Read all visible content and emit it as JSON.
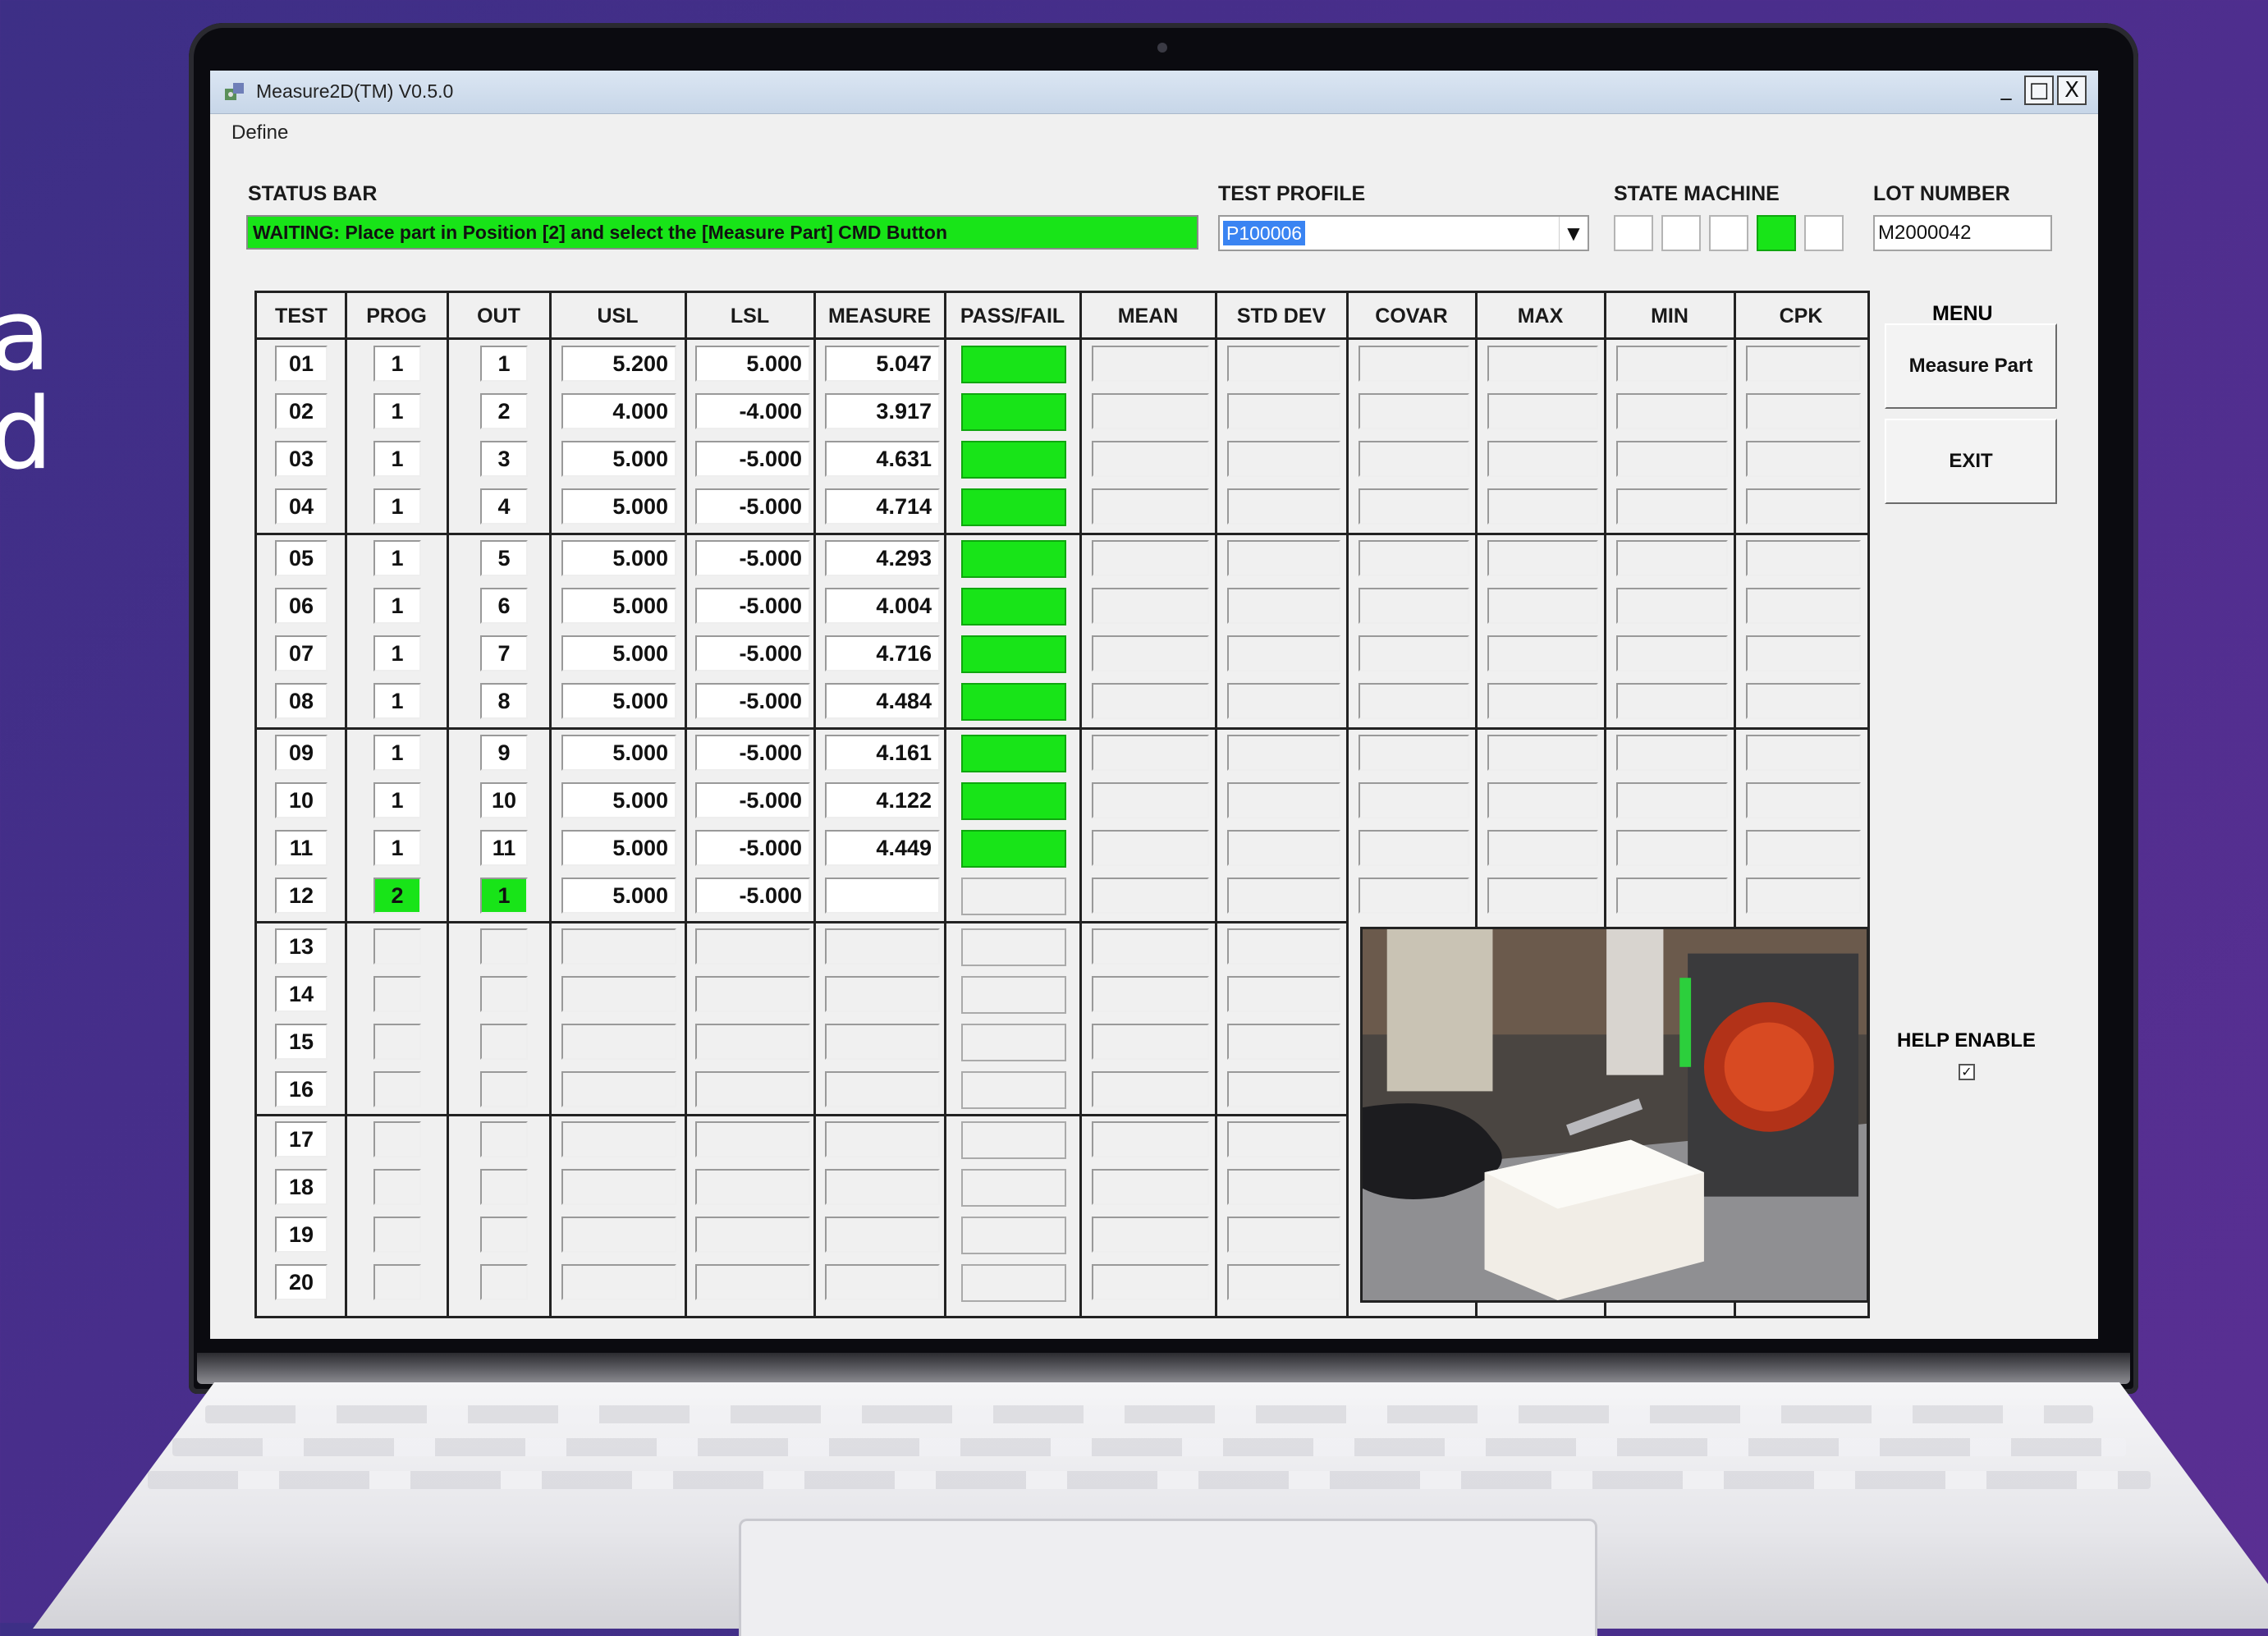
{
  "background_text": [
    "a",
    "d"
  ],
  "window": {
    "title": "Measure2D(TM) V0.5.0",
    "menu": [
      "Define"
    ],
    "controls": [
      "_",
      "□",
      "X"
    ]
  },
  "status": {
    "label": "STATUS BAR",
    "text": "WAITING: Place part in Position [2] and select the [Measure Part] CMD Button",
    "color": "#18e418"
  },
  "test_profile": {
    "label": "TEST PROFILE",
    "value": "P100006"
  },
  "state_machine": {
    "label": "STATE MACHINE",
    "states": [
      false,
      false,
      false,
      true,
      false
    ]
  },
  "lot_number": {
    "label": "LOT NUMBER",
    "value": "M2000042"
  },
  "columns": [
    "TEST",
    "PROG",
    "OUT",
    "USL",
    "LSL",
    "MEASURE",
    "PASS/FAIL",
    "MEAN",
    "STD DEV",
    "COVAR",
    "MAX",
    "MIN",
    "CPK"
  ],
  "rows": [
    {
      "test": "01",
      "prog": "1",
      "out": "1",
      "usl": "5.200",
      "lsl": "5.000",
      "measure": "5.047",
      "pass": true
    },
    {
      "test": "02",
      "prog": "1",
      "out": "2",
      "usl": "4.000",
      "lsl": "-4.000",
      "measure": "3.917",
      "pass": true
    },
    {
      "test": "03",
      "prog": "1",
      "out": "3",
      "usl": "5.000",
      "lsl": "-5.000",
      "measure": "4.631",
      "pass": true
    },
    {
      "test": "04",
      "prog": "1",
      "out": "4",
      "usl": "5.000",
      "lsl": "-5.000",
      "measure": "4.714",
      "pass": true
    },
    {
      "test": "05",
      "prog": "1",
      "out": "5",
      "usl": "5.000",
      "lsl": "-5.000",
      "measure": "4.293",
      "pass": true
    },
    {
      "test": "06",
      "prog": "1",
      "out": "6",
      "usl": "5.000",
      "lsl": "-5.000",
      "measure": "4.004",
      "pass": true
    },
    {
      "test": "07",
      "prog": "1",
      "out": "7",
      "usl": "5.000",
      "lsl": "-5.000",
      "measure": "4.716",
      "pass": true
    },
    {
      "test": "08",
      "prog": "1",
      "out": "8",
      "usl": "5.000",
      "lsl": "-5.000",
      "measure": "4.484",
      "pass": true
    },
    {
      "test": "09",
      "prog": "1",
      "out": "9",
      "usl": "5.000",
      "lsl": "-5.000",
      "measure": "4.161",
      "pass": true
    },
    {
      "test": "10",
      "prog": "1",
      "out": "10",
      "usl": "5.000",
      "lsl": "-5.000",
      "measure": "4.122",
      "pass": true
    },
    {
      "test": "11",
      "prog": "1",
      "out": "11",
      "usl": "5.000",
      "lsl": "-5.000",
      "measure": "4.449",
      "pass": true
    },
    {
      "test": "12",
      "prog": "2",
      "out": "1",
      "usl": "5.000",
      "lsl": "-5.000",
      "measure": "",
      "pass": null,
      "active": true
    },
    {
      "test": "13",
      "prog": "",
      "out": "",
      "usl": "",
      "lsl": "",
      "measure": "",
      "pass": null
    },
    {
      "test": "14",
      "prog": "",
      "out": "",
      "usl": "",
      "lsl": "",
      "measure": "",
      "pass": null
    },
    {
      "test": "15",
      "prog": "",
      "out": "",
      "usl": "",
      "lsl": "",
      "measure": "",
      "pass": null
    },
    {
      "test": "16",
      "prog": "",
      "out": "",
      "usl": "",
      "lsl": "",
      "measure": "",
      "pass": null
    },
    {
      "test": "17",
      "prog": "",
      "out": "",
      "usl": "",
      "lsl": "",
      "measure": "",
      "pass": null
    },
    {
      "test": "18",
      "prog": "",
      "out": "",
      "usl": "",
      "lsl": "",
      "measure": "",
      "pass": null
    },
    {
      "test": "19",
      "prog": "",
      "out": "",
      "usl": "",
      "lsl": "",
      "measure": "",
      "pass": null
    },
    {
      "test": "20",
      "prog": "",
      "out": "",
      "usl": "",
      "lsl": "",
      "measure": "",
      "pass": null
    }
  ],
  "menu": {
    "label": "MENU",
    "buttons": [
      "Measure Part",
      "EXIT"
    ]
  },
  "help": {
    "label": "HELP ENABLE",
    "checked": true,
    "mark": "✓"
  },
  "colors": {
    "pass": "#18e418",
    "active": "#18e418",
    "background": "#4a2e8c"
  }
}
